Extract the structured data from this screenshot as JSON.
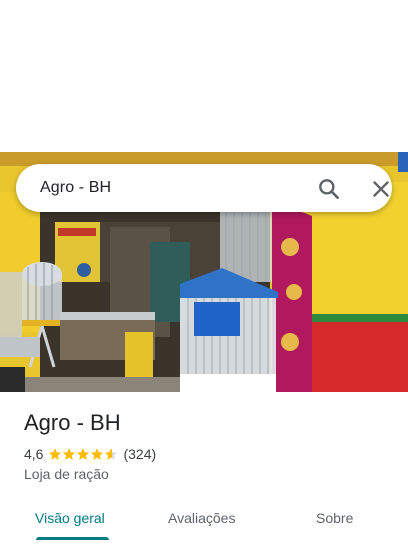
{
  "search": {
    "query": "Agro - BH"
  },
  "place": {
    "name": "Agro - BH",
    "rating": "4,6",
    "stars": 4.6,
    "review_count": "(324)",
    "category": "Loja de ração"
  },
  "tabs": [
    {
      "label": "Visão geral",
      "active": true
    },
    {
      "label": "Avaliações",
      "active": false
    },
    {
      "label": "Sobre",
      "active": false
    }
  ],
  "colors": {
    "accent": "#007b83",
    "star": "#fbbc04"
  },
  "icons": {
    "search": "search-icon",
    "close": "close-icon",
    "star": "star-icon"
  }
}
